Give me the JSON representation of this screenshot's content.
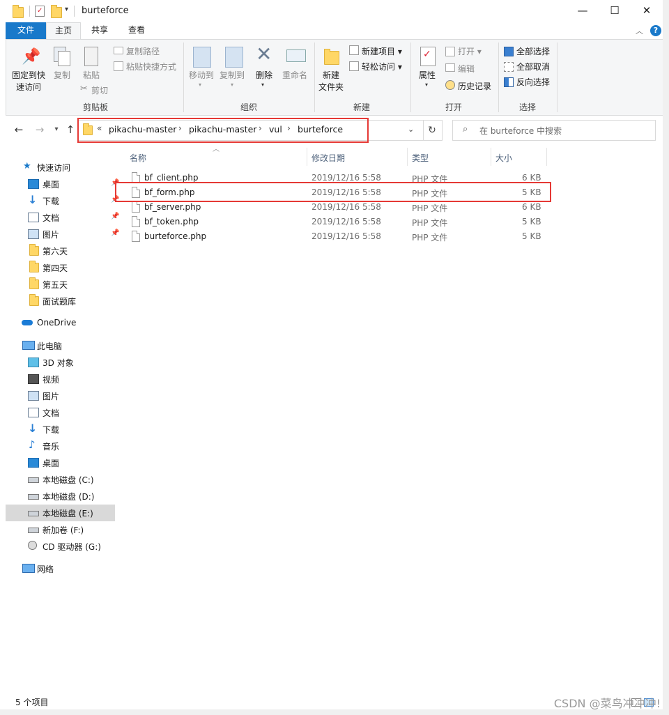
{
  "window": {
    "title": "burteforce",
    "minimize": "—",
    "maximize": "☐",
    "close": "✕"
  },
  "ribbon_tabs": [
    "文件",
    "主页",
    "共享",
    "查看"
  ],
  "ribbon": {
    "clipboard": {
      "pin_quick_access": "固定到快\n速访问",
      "copy": "复制",
      "paste": "粘贴",
      "copy_path": "复制路径",
      "paste_shortcut": "粘贴快捷方式",
      "cut": "剪切",
      "group_label": "剪贴板"
    },
    "organize": {
      "move_to": "移动到",
      "copy_to": "复制到",
      "delete": "删除",
      "rename": "重命名",
      "group_label": "组织"
    },
    "new": {
      "new_folder": "新建\n文件夹",
      "new_item": "新建项目",
      "easy_access": "轻松访问",
      "group_label": "新建"
    },
    "open": {
      "properties": "属性",
      "open": "打开",
      "edit": "编辑",
      "history": "历史记录",
      "group_label": "打开"
    },
    "select": {
      "select_all": "全部选择",
      "select_none": "全部取消",
      "invert": "反向选择",
      "group_label": "选择"
    }
  },
  "address": {
    "prefix": "«",
    "crumbs": [
      "pikachu-master",
      "pikachu-master",
      "vul",
      "burteforce"
    ],
    "search_placeholder": "在 burteforce 中搜索"
  },
  "nav": {
    "quick_access": "快速访问",
    "quick_items": [
      "桌面",
      "下载",
      "文档",
      "图片",
      "第六天",
      "第四天",
      "第五天",
      "面试题库"
    ],
    "onedrive": "OneDrive",
    "this_pc": "此电脑",
    "pc_items": [
      "3D 对象",
      "视频",
      "图片",
      "文档",
      "下载",
      "音乐",
      "桌面",
      "本地磁盘 (C:)",
      "本地磁盘 (D:)",
      "本地磁盘 (E:)",
      "新加卷 (F:)",
      "CD 驱动器 (G:)"
    ],
    "network": "网络"
  },
  "columns": {
    "name": "名称",
    "modified": "修改日期",
    "type": "类型",
    "size": "大小"
  },
  "files": [
    {
      "name": "bf_client.php",
      "modified": "2019/12/16 5:58",
      "type": "PHP 文件",
      "size": "6 KB"
    },
    {
      "name": "bf_form.php",
      "modified": "2019/12/16 5:58",
      "type": "PHP 文件",
      "size": "5 KB"
    },
    {
      "name": "bf_server.php",
      "modified": "2019/12/16 5:58",
      "type": "PHP 文件",
      "size": "6 KB"
    },
    {
      "name": "bf_token.php",
      "modified": "2019/12/16 5:58",
      "type": "PHP 文件",
      "size": "5 KB"
    },
    {
      "name": "burteforce.php",
      "modified": "2019/12/16 5:58",
      "type": "PHP 文件",
      "size": "5 KB"
    }
  ],
  "status": "5 个项目",
  "watermark": "CSDN @菜鸟冲冲冲!",
  "colors": {
    "accent": "#1979ca",
    "highlight": "#e53935",
    "folder": "#ffd766"
  }
}
